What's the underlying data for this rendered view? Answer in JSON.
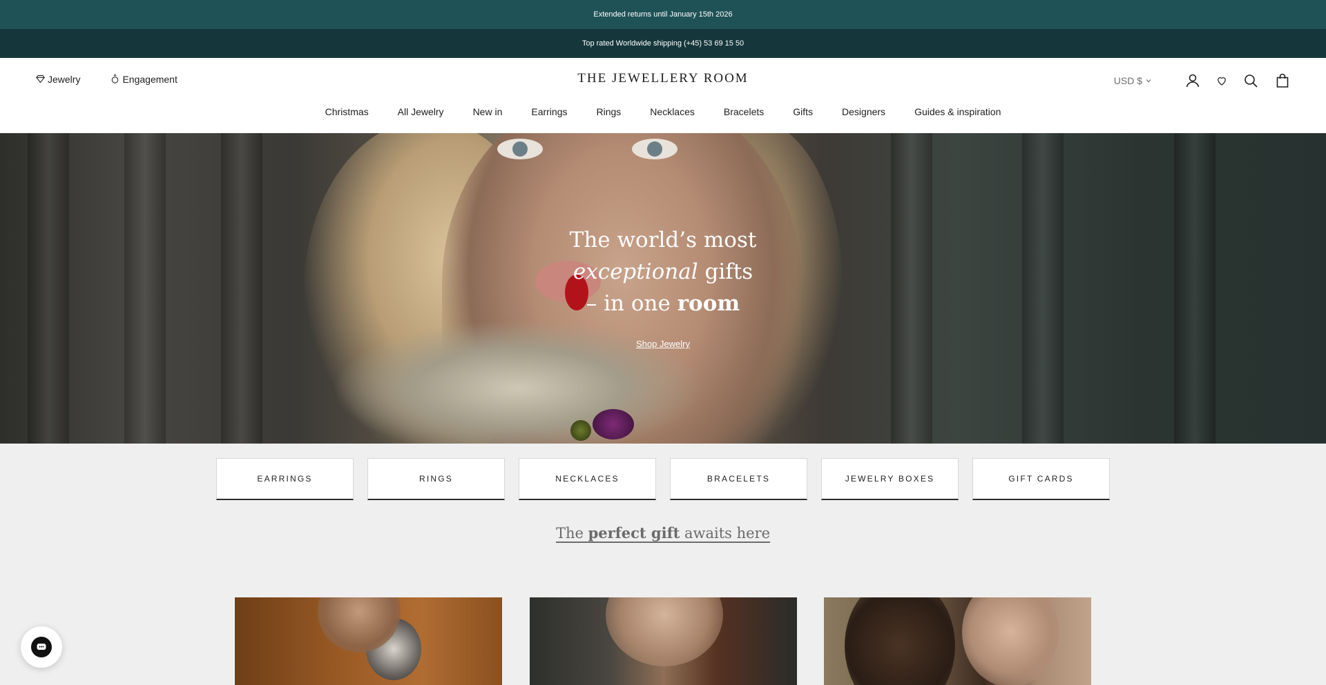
{
  "announcements": {
    "line1": " Extended returns until January 15th 2026",
    "line2": " Top rated  Worldwide shipping   (+45) 53 69 15 50"
  },
  "header": {
    "left_links": [
      {
        "label": "Jewelry",
        "icon": "diamond-icon"
      },
      {
        "label": "Engagement",
        "icon": "ring-icon"
      }
    ],
    "logo": "THE JEWELLERY ROOM",
    "currency": "USD $",
    "icons": [
      "account-icon",
      "wishlist-icon",
      "search-icon",
      "cart-icon"
    ]
  },
  "nav": {
    "items": [
      " Christmas",
      "All Jewelry",
      "New in",
      "Earrings",
      "Rings",
      "Necklaces",
      "Bracelets",
      "Gifts",
      "Designers",
      "Guides & inspiration"
    ]
  },
  "hero": {
    "line1": "The world’s most",
    "line2_em": "exceptional",
    "line2_rest": " gifts",
    "line3_pre": "– in one ",
    "line3_bold": "room",
    "cta": "Shop Jewelry"
  },
  "categories": [
    "EARRINGS",
    "RINGS",
    "NECKLACES",
    "BRACELETS",
    "JEWELRY BOXES",
    "GIFT CARDS"
  ],
  "tagline": {
    "pre": "The ",
    "bold": "perfect gift",
    "post": " awaits here "
  },
  "chat": {
    "icon": "chat-bubble-icon"
  },
  "colors": {
    "announcement_bar_1": "#1f5257",
    "announcement_bar_2": "#15373b",
    "page_bg": "#efefef"
  }
}
